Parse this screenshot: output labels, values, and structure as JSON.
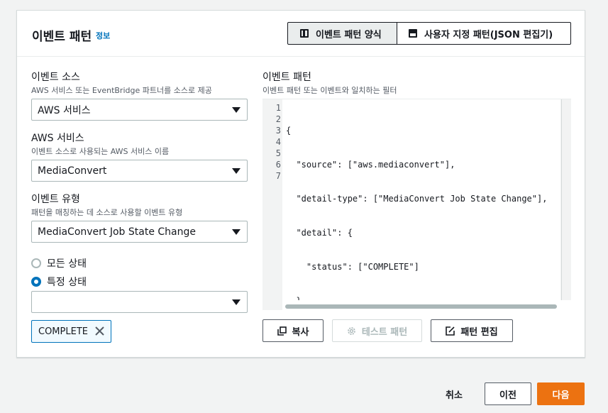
{
  "header": {
    "title": "이벤트 패턴",
    "info_link": "정보",
    "segments": [
      {
        "label": "이벤트 패턴 양식",
        "active": true
      },
      {
        "label": "사용자 지정 패턴(JSON 편집기)",
        "active": false
      }
    ]
  },
  "form": {
    "event_source": {
      "label": "이벤트 소스",
      "description": "AWS 서비스 또는 EventBridge 파트너를 소스로 제공",
      "value": "AWS 서비스"
    },
    "aws_service": {
      "label": "AWS 서비스",
      "description": "이벤트 소스로 사용되는 AWS 서비스 이름",
      "value": "MediaConvert"
    },
    "event_type": {
      "label": "이벤트 유형",
      "description": "패턴을 매칭하는 데 소스로 사용할 이벤트 유형",
      "value": "MediaConvert Job State Change"
    },
    "radios": [
      {
        "label": "모든 상태",
        "checked": false
      },
      {
        "label": "특정 상태",
        "checked": true
      }
    ],
    "state_select": {
      "value": ""
    },
    "tokens": [
      {
        "label": "COMPLETE"
      }
    ]
  },
  "pattern": {
    "label": "이벤트 패턴",
    "description": "이벤트 패턴 또는 이벤트와 일치하는 필터",
    "line_numbers": [
      "1",
      "2",
      "3",
      "4",
      "5",
      "6",
      "7"
    ],
    "code_lines": [
      "{",
      "  \"source\": [\"aws.mediaconvert\"],",
      "  \"detail-type\": [\"MediaConvert Job State Change\"],",
      "  \"detail\": {",
      "    \"status\": [\"COMPLETE\"]",
      "  }",
      "}"
    ],
    "buttons": {
      "copy": "복사",
      "test": "테스트 패턴",
      "edit": "패턴 편집"
    }
  },
  "footer": {
    "cancel": "취소",
    "prev": "이전",
    "next": "다음"
  },
  "colors": {
    "accent": "#0073bb",
    "primary_button": "#ec7211"
  }
}
